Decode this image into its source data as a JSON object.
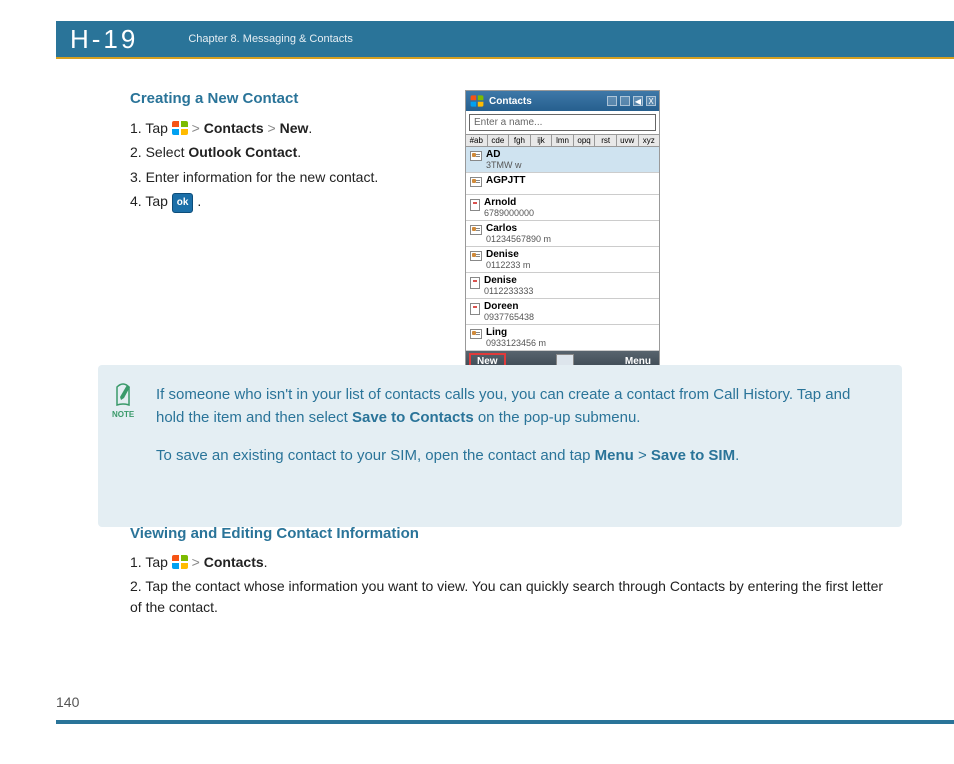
{
  "header": {
    "logo": "H-19",
    "chapter": "Chapter 8. Messaging & Contacts"
  },
  "section1": {
    "heading": "Creating a New Contact",
    "step1_pre": "1. Tap ",
    "step1_b1": "Contacts",
    "step1_b2": "New",
    "step1_end": ".",
    "step2_pre": "2. Select ",
    "step2_b": "Outlook Contact",
    "step2_end": ".",
    "step3": "3. Enter information for the new contact.",
    "step4_pre": "4. Tap ",
    "step4_end": " .",
    "ok_label": "ok"
  },
  "device": {
    "title": "Contacts",
    "search_placeholder": "Enter a name...",
    "alpha": [
      "#ab",
      "cde",
      "fgh",
      "ijk",
      "lmn",
      "opq",
      "rst",
      "uvw",
      "xyz"
    ],
    "contacts": [
      {
        "name": "AD",
        "sub": "3TMW  w",
        "sim": false,
        "hl": true
      },
      {
        "name": "AGPJTT",
        "sub": "",
        "sim": false,
        "hl": false
      },
      {
        "name": "Arnold",
        "sub": "6789000000",
        "sim": true,
        "hl": false
      },
      {
        "name": "Carlos",
        "sub": "01234567890  m",
        "sim": false,
        "hl": false
      },
      {
        "name": "Denise",
        "sub": "0112233  m",
        "sim": false,
        "hl": false
      },
      {
        "name": "Denise",
        "sub": "0112233333",
        "sim": true,
        "hl": false
      },
      {
        "name": "Doreen",
        "sub": "0937765438",
        "sim": true,
        "hl": false
      },
      {
        "name": "Ling",
        "sub": "0933123456  m",
        "sim": false,
        "hl": false
      }
    ],
    "new_label": "New",
    "menu_label": "Menu",
    "close_label": "X"
  },
  "note": {
    "label": "NOTE",
    "p1_a": "If someone who isn't in your list of contacts calls you, you can create a contact from Call History. Tap and hold the item and then select ",
    "p1_b": "Save to Contacts",
    "p1_c": " on the pop-up submenu.",
    "p2_a": "To save an existing contact to your SIM, open the contact and tap ",
    "p2_b": "Menu",
    "p2_gt": " > ",
    "p2_c": "Save to SIM",
    "p2_d": "."
  },
  "section2": {
    "heading": "Viewing and Editing Contact Information",
    "s1_pre": "1. Tap ",
    "s1_b": "Contacts",
    "s1_end": ".",
    "s2": "2. Tap the contact whose information you want to view. You can quickly search through Contacts by entering the first letter of the contact."
  },
  "page_number": "140"
}
